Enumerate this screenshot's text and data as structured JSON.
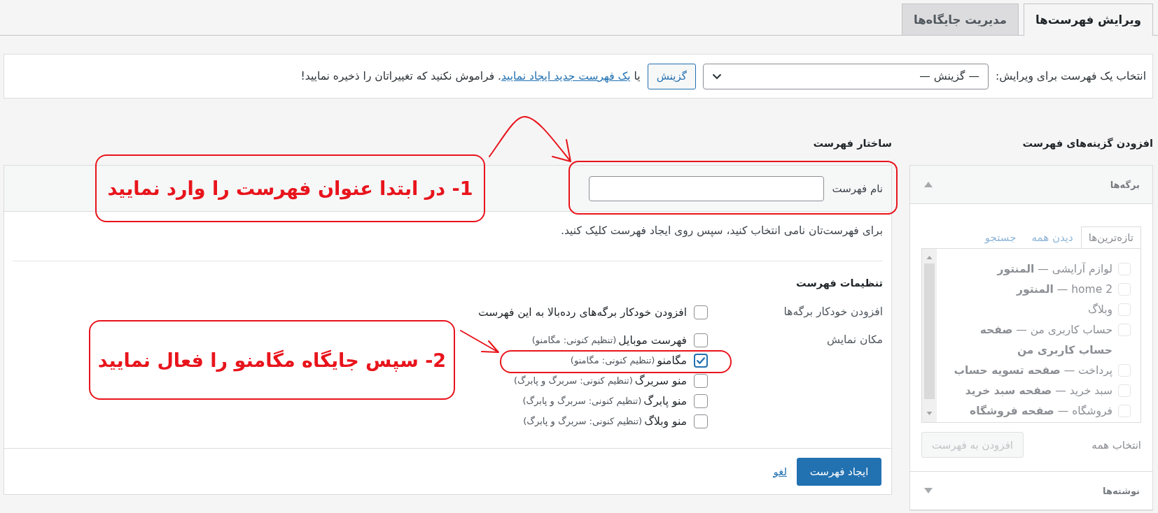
{
  "tabs": [
    {
      "label": "ویرایش فهرست‌ها",
      "selected": true
    },
    {
      "label": "مدیریت جایگاه‌ها",
      "selected": false
    }
  ],
  "menu_select_bar": {
    "label": "انتخاب یک فهرست برای ویرایش:",
    "dropdown_value": "— گزینش —",
    "select_button": "گزینش",
    "text_before_link": "یا",
    "link": "یک فهرست جدید ایجاد نمایید",
    "text_after_link": ". فراموش نکنید که تغییراتان را ذخیره نمایید!"
  },
  "add_items": {
    "heading": "افزودن گزینه‌های فهرست",
    "disabled": true,
    "panels": [
      {
        "title": "برگه‌ها",
        "expanded": true,
        "tabs": [
          {
            "label": "تازه‌ترین‌ها",
            "selected": true
          },
          {
            "label": "دیدن همه",
            "selected": false
          },
          {
            "label": "جستجو",
            "selected": false
          }
        ],
        "items": [
          {
            "label": "لوازم آرایشی — **المنتور**",
            "checked": false
          },
          {
            "label": "home 2 — **المنتور**",
            "checked": false
          },
          {
            "label": "وبلاگ",
            "checked": false
          },
          {
            "label": "حساب کاربری من — **صفحه حساب کاربری من**",
            "checked": false
          },
          {
            "label": "پرداخت — **صفحه تسویه حساب**",
            "checked": false
          },
          {
            "label": "سبد خرید — **صفحه سبد خرید**",
            "checked": false
          },
          {
            "label": "فروشگاه — **صفحه فروشگاه**",
            "checked": false
          }
        ],
        "select_all": "انتخاب همه",
        "add_button": {
          "label": "افزودن به فهرست",
          "disabled": true
        }
      },
      {
        "title": "نوشته‌ها",
        "expanded": false
      }
    ]
  },
  "menu_structure": {
    "heading": "ساختار فهرست",
    "name_label": "نام فهرست",
    "instructions": "برای فهرست‌تان نامی انتخاب کنید، سپس روی ایجاد فهرست کلیک کنید.",
    "settings_heading": "تنظیمات فهرست",
    "settings": [
      {
        "label": "افزودن خودکار برگه‌ها",
        "options": [
          {
            "label": "افزودن خودکار برگه‌های رده‌بالا به این فهرست",
            "checked": false
          }
        ]
      },
      {
        "label": "مکان نمایش",
        "options": [
          {
            "label": "فهرست موبایل",
            "note": "(تنظیم کنونی: مگامنو)",
            "checked": false
          },
          {
            "label": "مگامنو",
            "note": "(تنظیم کنونی: مگامنو)",
            "checked": true
          },
          {
            "label": "منو سربرگ",
            "note": "(تنظیم کنونی: سربرگ و پابرگ)",
            "checked": false
          },
          {
            "label": "منو پابرگ",
            "note": "(تنظیم کنونی: سربرگ و پابرگ)",
            "checked": false
          },
          {
            "label": "منو وبلاگ",
            "note": "(تنظیم کنونی: سربرگ و پابرگ)",
            "checked": false
          }
        ]
      }
    ],
    "create_button": "ایجاد فهرست",
    "cancel_link": "لغو"
  },
  "annotations": [
    {
      "text": "1- در ابتدا عنوان فهرست را وارد نمایید"
    },
    {
      "text": "2- سپس جایگاه مگامنو را فعال نمایید"
    }
  ]
}
